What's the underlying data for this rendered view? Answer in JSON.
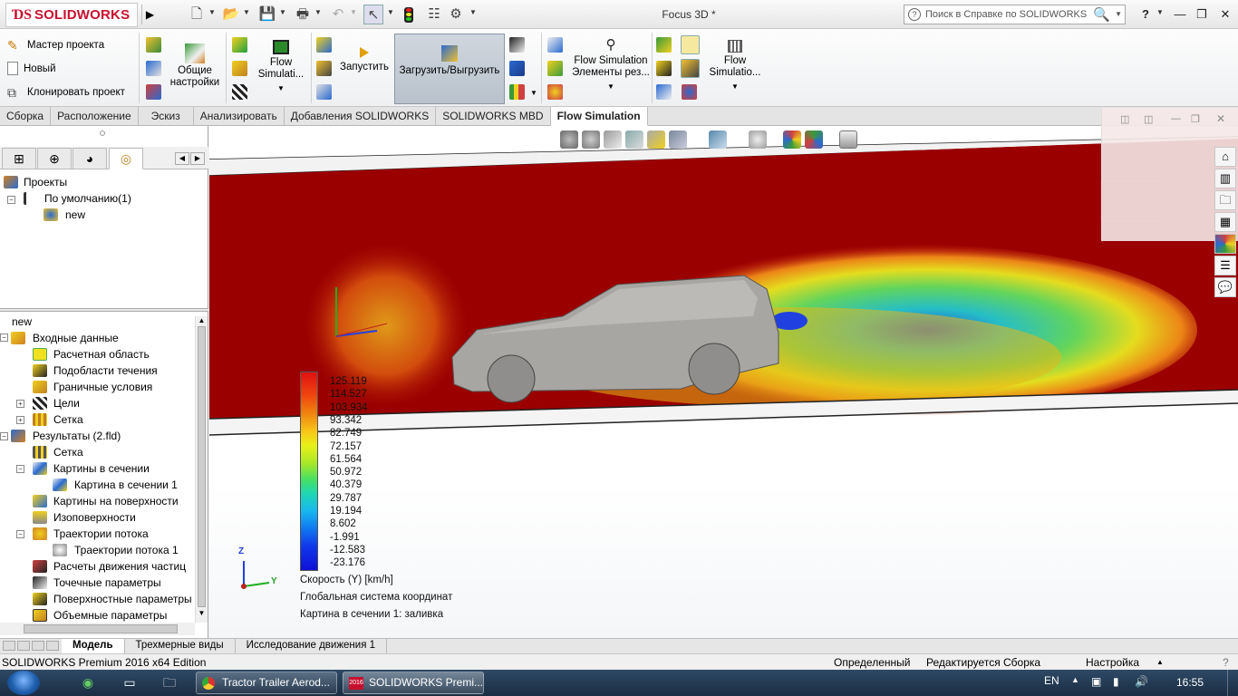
{
  "titlebar": {
    "logo_text": "SOLIDWORKS",
    "doc_title": "Focus 3D *",
    "search_placeholder": "Поиск в Справке по SOLIDWORKS",
    "help_label": "?"
  },
  "ribbon": {
    "wizard": "Мастер проекта",
    "new": "Новый",
    "clone": "Клонировать проект",
    "general_settings": "Общие настройки",
    "flow_sim_1": "Flow Simulati...",
    "run": "Запустить",
    "load_unload": "Загрузить/Выгрузить",
    "flow_sim_results": "Flow Simulation Элементы рез...",
    "flow_sim_2": "Flow Simulatio..."
  },
  "tabs": [
    {
      "label": "Сборка"
    },
    {
      "label": "Расположение"
    },
    {
      "label": "Эскиз"
    },
    {
      "label": "Анализировать"
    },
    {
      "label": "Добавления SOLIDWORKS"
    },
    {
      "label": "SOLIDWORKS MBD"
    },
    {
      "label": "Flow Simulation"
    }
  ],
  "project_tree": {
    "projects": "Проекты",
    "default": "По умолчанию(1)",
    "new": "new"
  },
  "analysis_tree": {
    "root": "new",
    "items": [
      {
        "label": "Входные данные"
      },
      {
        "label": "Расчетная область"
      },
      {
        "label": "Подобласти течения"
      },
      {
        "label": "Граничные условия"
      },
      {
        "label": "Цели"
      },
      {
        "label": "Сетка"
      },
      {
        "label": "Результаты (2.fld)"
      },
      {
        "label": "Сетка"
      },
      {
        "label": "Картины в сечении"
      },
      {
        "label": "Картина в сечении 1"
      },
      {
        "label": "Картины на поверхности"
      },
      {
        "label": "Изоповерхности"
      },
      {
        "label": "Траектории потока"
      },
      {
        "label": "Траектории потока 1"
      },
      {
        "label": "Расчеты движения частиц"
      },
      {
        "label": "Точечные параметры"
      },
      {
        "label": "Поверхностные параметры"
      },
      {
        "label": "Объемные параметры"
      }
    ]
  },
  "legend": {
    "values": [
      "125.119",
      "114.527",
      "103.934",
      "93.342",
      "82.749",
      "72.157",
      "61.564",
      "50.972",
      "40.379",
      "29.787",
      "19.194",
      "8.602",
      "-1.991",
      "-12.583",
      "-23.176"
    ],
    "quantity": "Скорость (Y) [km/h]",
    "coord_system": "Глобальная система координат",
    "plot_name": "Картина в сечении 1: заливка"
  },
  "triad": {
    "z": "Z",
    "y": "Y"
  },
  "bottom_tabs": [
    {
      "label": "Модель"
    },
    {
      "label": "Трехмерные виды"
    },
    {
      "label": "Исследование движения 1"
    }
  ],
  "status": {
    "edition": "SOLIDWORKS Premium 2016 x64 Edition",
    "defined": "Определенный",
    "editing": "Редактируется Сборка",
    "settings": "Настройка"
  },
  "taskbar": {
    "app1": "Tractor Trailer Aerod...",
    "app2": "SOLIDWORKS Premi...",
    "lang": "EN",
    "time": "16:55"
  },
  "colors": {
    "accent": "#c8102e",
    "flow_red": "#9b0000"
  }
}
